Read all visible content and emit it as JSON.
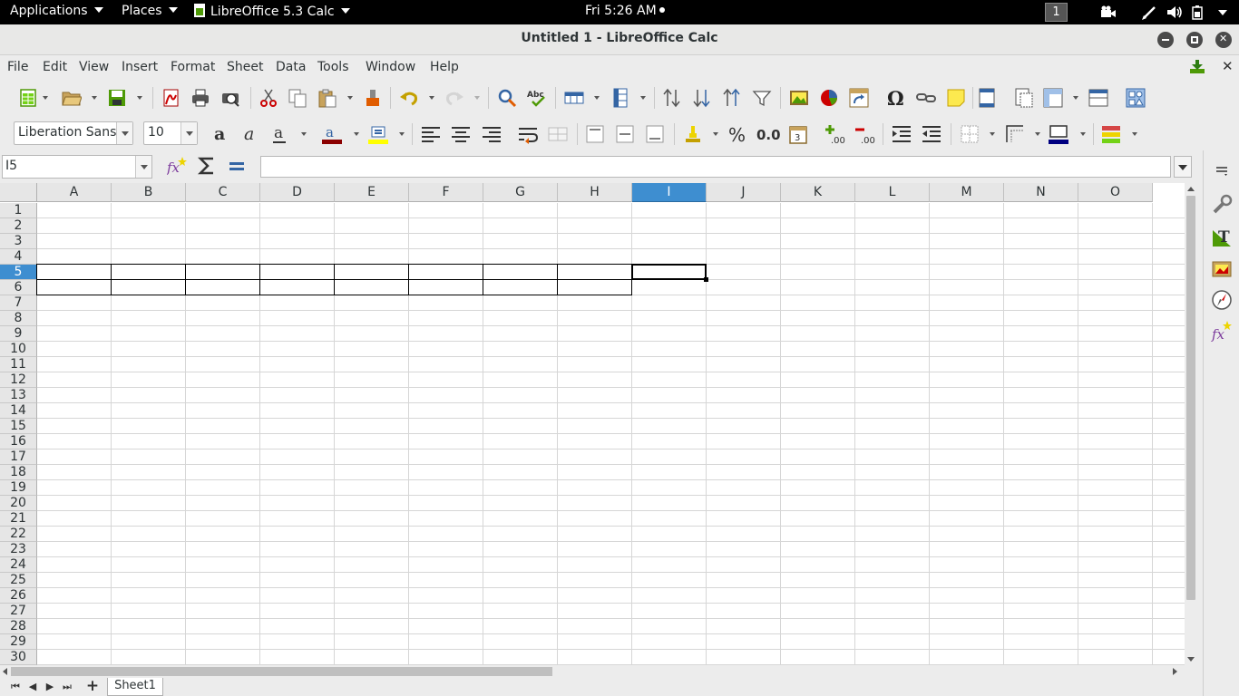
{
  "topbar": {
    "applications": "Applications",
    "places": "Places",
    "app_name": "LibreOffice 5.3 Calc",
    "clock": "Fri  5:26 AM",
    "workspace": "1"
  },
  "window": {
    "title": "Untitled 1 - LibreOffice Calc"
  },
  "menu": [
    "File",
    "Edit",
    "View",
    "Insert",
    "Format",
    "Sheet",
    "Data",
    "Tools",
    "Window",
    "Help"
  ],
  "formatting": {
    "font_name": "Liberation Sans",
    "font_size": "10"
  },
  "formula_bar": {
    "name_box": "I5",
    "formula": ""
  },
  "columns": [
    "A",
    "B",
    "C",
    "D",
    "E",
    "F",
    "G",
    "H",
    "I",
    "J",
    "K",
    "L",
    "M",
    "N",
    "O"
  ],
  "rows": [
    "1",
    "2",
    "3",
    "4",
    "5",
    "6",
    "7",
    "8",
    "9",
    "10",
    "11",
    "12",
    "13",
    "14",
    "15",
    "16",
    "17",
    "18",
    "19",
    "20",
    "21",
    "22",
    "23",
    "24",
    "25",
    "26",
    "27",
    "28",
    "29",
    "30"
  ],
  "selected_cell": {
    "column": "I",
    "row": "5"
  },
  "sheets": [
    "Sheet1"
  ],
  "colors": {
    "selection_header": "#3e8ed0",
    "font_color": "#8b0000",
    "highlight_color": "#ffff00",
    "border_color": "#000080"
  },
  "icons": {
    "toolbar1": [
      "new-icon",
      "open-icon",
      "save-icon",
      "export-pdf-icon",
      "print-icon",
      "print-preview-icon",
      "cut-icon",
      "copy-icon",
      "paste-icon",
      "clone-formatting-icon",
      "undo-icon",
      "redo-icon",
      "find-replace-icon",
      "spelling-icon",
      "row-icon",
      "column-icon",
      "sort-icon",
      "sort-ascending-icon",
      "sort-descending-icon",
      "autofilter-icon",
      "image-icon",
      "chart-icon",
      "pivot-table-icon",
      "special-character-icon",
      "hyperlink-icon",
      "comment-icon",
      "headers-footers-icon",
      "define-print-area-icon",
      "freeze-rows-columns-icon",
      "split-window-icon",
      "show-draw-functions-icon"
    ],
    "toolbar2": [
      "bold-icon",
      "italic-icon",
      "underline-icon",
      "font-color-icon",
      "highlight-icon",
      "align-left-icon",
      "align-center-icon",
      "align-right-icon",
      "wrap-text-icon",
      "merge-cells-icon",
      "align-top-icon",
      "align-middle-icon",
      "align-bottom-icon",
      "currency-icon",
      "percent-icon",
      "number-format-icon",
      "date-icon",
      "add-decimal-icon",
      "delete-decimal-icon",
      "increase-indent-icon",
      "decrease-indent-icon",
      "borders-icon",
      "border-style-icon",
      "border-color-icon",
      "conditional-format-icon"
    ],
    "sidebar": [
      "sidebar-menu-icon",
      "properties-icon",
      "styles-icon",
      "gallery-icon",
      "navigator-icon",
      "functions-icon"
    ]
  }
}
